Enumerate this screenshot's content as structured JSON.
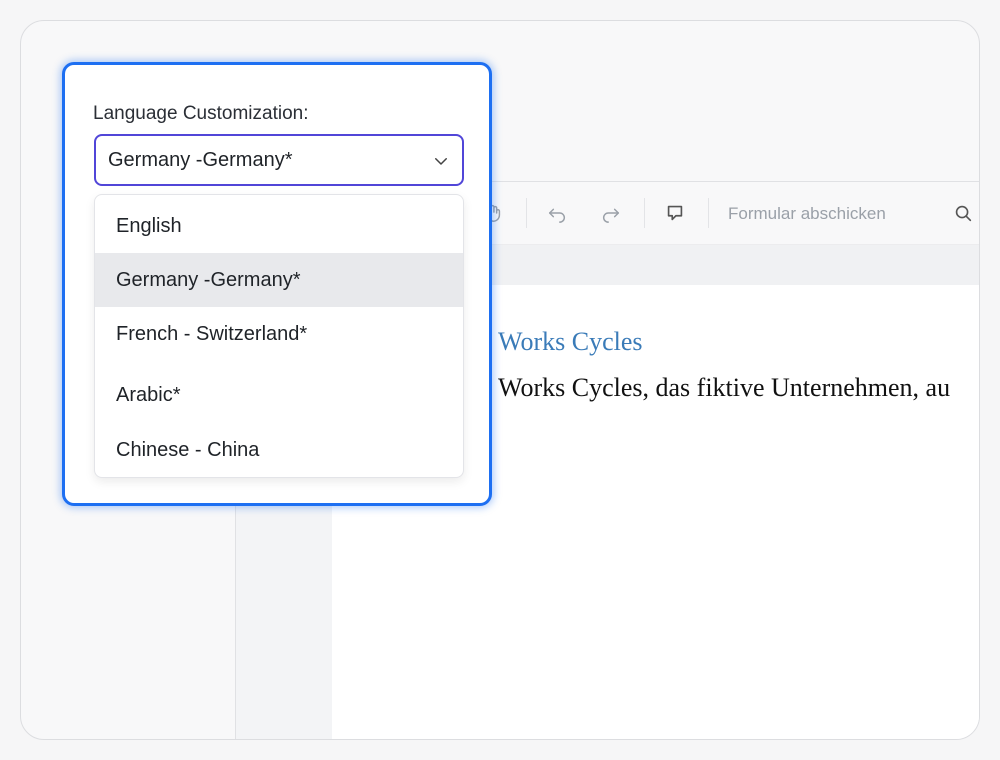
{
  "language": {
    "label": "Language Customization:",
    "selected": "Germany -Germany*",
    "options": [
      {
        "label": "English"
      },
      {
        "label": "Germany -Germany*"
      },
      {
        "label": "French - Switzerland*"
      },
      {
        "label": "Arabic*"
      },
      {
        "label": "Chinese - China"
      }
    ]
  },
  "toolbar": {
    "submit_label": "Formular abschicken"
  },
  "document": {
    "heading": "Works Cycles",
    "body": "Works Cycles, das fiktive Unternehmen, au"
  }
}
